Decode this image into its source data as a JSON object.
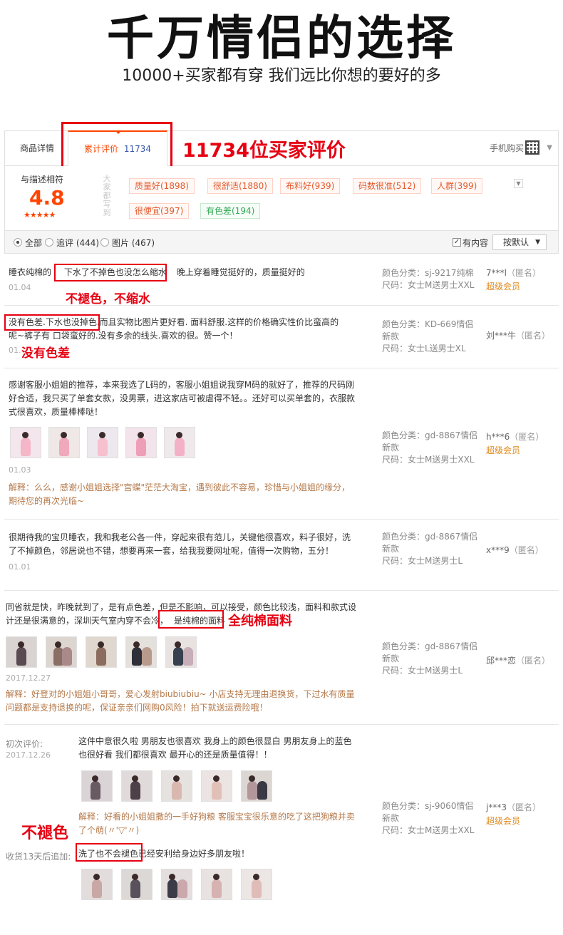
{
  "banner": {
    "headline": "千万情侣的选择",
    "subline": "10000+买家都有穿 我们远比你想的要好的多"
  },
  "tabs": {
    "details": "商品详情",
    "reviews_label": "累计评价",
    "reviews_count": "11734",
    "mobile_buy": "手机购买"
  },
  "annotations": {
    "buyers_reviewed": "11734位买家评价",
    "no_fade": "不褪色，不缩水",
    "no_color_diff": "没有色差",
    "full_cotton": "全纯棉面料",
    "no_fade_2": "不褪色"
  },
  "rating": {
    "label": "与描述相符",
    "score": "4.8",
    "stars": "★★★★★",
    "vertical_label": "大家都写到",
    "tags": [
      {
        "text": "质量好(1898)",
        "tone": "red"
      },
      {
        "text": "很舒适(1880)",
        "tone": "red"
      },
      {
        "text": "布料好(939)",
        "tone": "red"
      },
      {
        "text": "码数很准(512)",
        "tone": "red"
      },
      {
        "text": "人群(399)",
        "tone": "red"
      },
      {
        "text": "很便宜(397)",
        "tone": "red"
      },
      {
        "text": "有色差(194)",
        "tone": "green"
      }
    ],
    "more_icon": "chevron-down-icon"
  },
  "filter": {
    "all": "全部",
    "followup": "追评 (444)",
    "images": "图片 (467)",
    "has_content": "有内容",
    "sort": "按默认"
  },
  "reviews": [
    {
      "text_a": "睡衣纯棉的",
      "text_highlight": "下水了不掉色也没怎么缩水",
      "text_b": "晚上穿着睡觉挺好的，质量挺好的",
      "date": "01.04",
      "sku_color": "颜色分类：sj-9217纯棉",
      "sku_size": "尺码：女士M送男士XXL",
      "user": "7***l",
      "anon": "（匿名）",
      "vip": "超级会员"
    },
    {
      "text_highlight": "没有色差.下水也没掉色.",
      "text_a": "而且实物比图片更好看. 面料舒服.这样的价格确实性价比蛮高的",
      "text_b": "呢~裤子有 口袋蛮好的.没有多余的线头.喜欢的很。赞一个！",
      "date": "01.",
      "sku_color": "颜色分类：KD-669情侣新款",
      "sku_size": "尺码：女士L送男士XL",
      "user": "刘***牛",
      "anon": "（匿名）"
    },
    {
      "text": "感谢客服小姐姐的推荐，本来我选了L码的，客服小姐姐说我穿M码的就好了，推荐的尺码刚好合适，我只买了单套女款，没男票，进这家店可被虐得不轻。。还好可以买单套的，衣服款式很喜欢，质量棒棒哒！",
      "date": "01.03",
      "reply": "解释：么么，感谢小姐姐选择\"宫蝶\"茫茫大淘宝，遇到彼此不容易，珍惜与小姐姐的缘分，期待您的再次光临~",
      "sku_color": "颜色分类：gd-8867情侣新款",
      "sku_size": "尺码：女士M送男士XXL",
      "user": "h***6",
      "anon": "（匿名）",
      "vip": "超级会员"
    },
    {
      "text": "很期待我的宝贝睡衣，我和我老公各一件，穿起来很有范儿，关键他很喜欢，料子很好，洗了不掉颜色，邻居说也不错，想要再来一套，给我我要网址呢，值得一次购物，五分！",
      "date": "01.01",
      "sku_color": "颜色分类：gd-8867情侣新款",
      "sku_size": "尺码：女士M送男士L",
      "user": "x***9",
      "anon": "（匿名）"
    },
    {
      "text_a": "同省就是快，昨晚就到了，是有点色差，但是不影响，可以接受，颜色比较浅，面料和款式设计还是很满意的，深圳天气室内穿不会冷，",
      "text_highlight": "是纯棉的面料",
      "date": "2017.12.27",
      "reply": "解释：好登对的小姐姐小哥哥，爱心发射biubiubiu~ 小店支持无理由退换货，下过水有质量问题都是支持退换的呢，保证亲亲们网购0风险！拍下就送运费险哦！",
      "sku_color": "颜色分类：gd-8867情侣新款",
      "sku_size": "尺码：女士M送男士L",
      "user": "邱***恋",
      "anon": "（匿名）"
    },
    {
      "initial_label": "初次评价:",
      "date": "2017.12.26",
      "text": "这件中意很久啦 男朋友也很喜欢 我身上的颜色很显白 男朋友身上的蓝色也很好看 我们都很喜欢 最开心的还是质量值得！！",
      "reply": "解释：好看的小姐姐撒的一手好狗粮 客服宝宝很乐意的吃了这把狗粮并卖了个萌(〃'▽'〃)",
      "followup_label": "收货13天后追加:",
      "followup_highlight": "洗了也不会褪色",
      "followup_text": "已经安利给身边好多朋友啦！",
      "sku_color": "颜色分类：sj-9060情侣新款",
      "sku_size": "尺码：女士M送男士XXL",
      "user": "j***3",
      "anon": "（匿名）",
      "vip": "超级会员"
    }
  ],
  "colors": {
    "accent": "#ff4400",
    "annotation_red": "#e60012",
    "reply_brown": "#b5794a",
    "vip_orange": "#e08a1e"
  }
}
